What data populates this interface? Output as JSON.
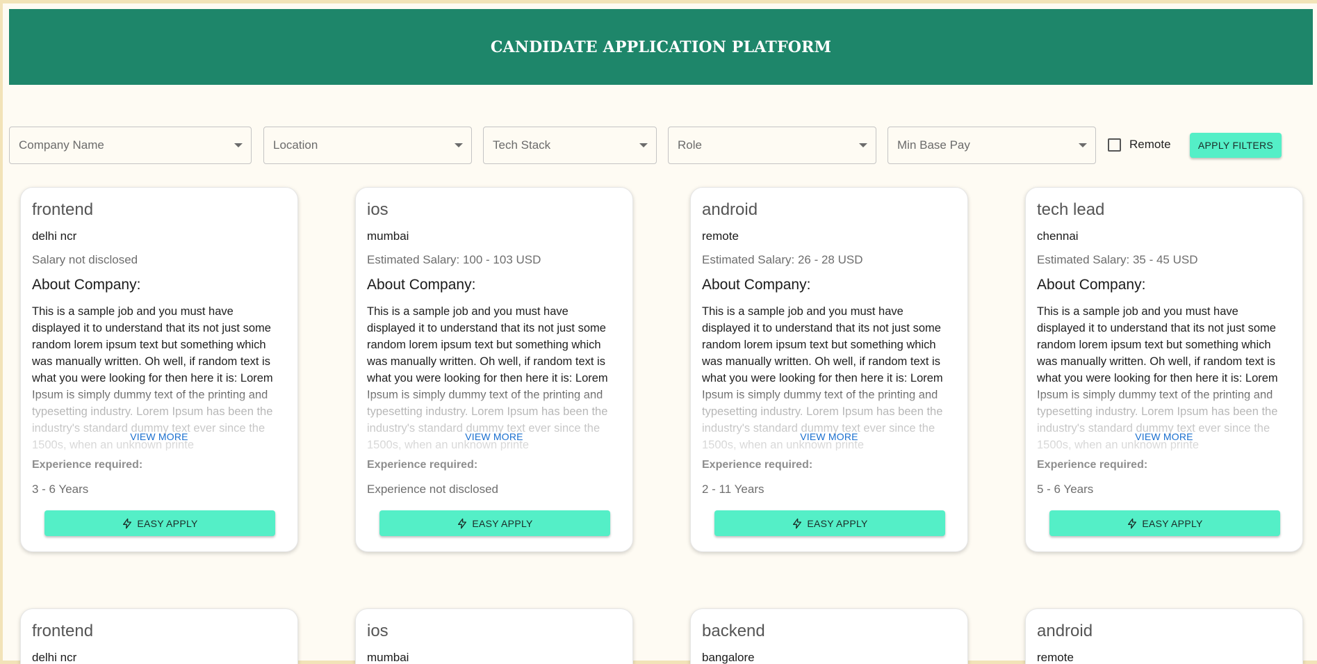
{
  "header": {
    "title": "CANDIDATE APPLICATION PLATFORM"
  },
  "filters": {
    "company": "Company Name",
    "location": "Location",
    "tech_stack": "Tech Stack",
    "role": "Role",
    "min_base_pay": "Min Base Pay",
    "remote_label": "Remote",
    "remote_checked": false,
    "apply_label": "APPLY FILTERS"
  },
  "common": {
    "about_title": "About Company:",
    "about_text": "This is a sample job and you must have displayed it to understand that its not just some random lorem ipsum text but something which was manually written. Oh well, if random text is what you were looking for then here it is: Lorem Ipsum is simply dummy text of the printing and typesetting industry. Lorem Ipsum has been the industry's standard dummy text ever since the 1500s, when an unknown printe",
    "view_more": "VIEW MORE",
    "experience_label": "Experience required:",
    "easy_apply": "EASY APPLY"
  },
  "jobs": [
    {
      "role": "frontend",
      "location": "delhi ncr",
      "salary": "Salary not disclosed",
      "experience": "3 - 6 Years"
    },
    {
      "role": "ios",
      "location": "mumbai",
      "salary": "Estimated Salary: 100 - 103 USD",
      "experience": "Experience not disclosed"
    },
    {
      "role": "android",
      "location": "remote",
      "salary": "Estimated Salary: 26 - 28 USD",
      "experience": "2 - 11 Years"
    },
    {
      "role": "tech lead",
      "location": "chennai",
      "salary": "Estimated Salary: 35 - 45 USD",
      "experience": "5 - 6 Years"
    }
  ],
  "jobs_row2": [
    {
      "role": "frontend",
      "location": "delhi ncr"
    },
    {
      "role": "ios",
      "location": "mumbai"
    },
    {
      "role": "backend",
      "location": "bangalore"
    },
    {
      "role": "android",
      "location": "remote"
    }
  ],
  "colors": {
    "header_bg": "#1e866a",
    "accent_button": "#54efc7",
    "link": "#1a6fcf",
    "page_bg": "#fefbf3"
  }
}
